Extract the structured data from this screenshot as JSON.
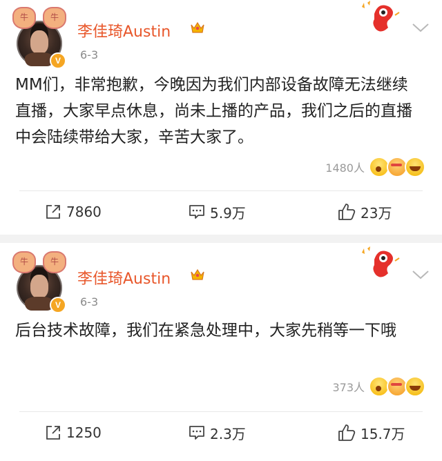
{
  "posts": [
    {
      "username": "李佳琦Austin",
      "date": "6-3",
      "verified_badge": "V",
      "avatar_badges": [
        "牛",
        "牛"
      ],
      "content": "MM们，非常抱歉，今晚因为我们内部设备故障无法继续直播，大家早点休息，尚未上播的产品，我们之后的直播中会陆续带给大家，辛苦大家了。",
      "reaction_count": "1480人",
      "reposts": "7860",
      "comments": "5.9万",
      "likes": "23万"
    },
    {
      "username": "李佳琦Austin",
      "date": "6-3",
      "verified_badge": "V",
      "avatar_badges": [
        "牛",
        "牛"
      ],
      "content": "后台技术故障，我们在紧急处理中，大家先稍等一下哦",
      "reaction_count": "373人",
      "reposts": "1250",
      "comments": "2.3万",
      "likes": "15.7万"
    }
  ],
  "icons": {
    "repost": "repost-icon",
    "comment": "comment-icon",
    "like": "thumbs-up-icon",
    "crown": "crown-icon",
    "mascot": "mascot-icon",
    "chevron": "chevron-down-icon"
  },
  "colors": {
    "username": "#e8572b",
    "verified": "#f5a623",
    "background": "#f2f2f2"
  }
}
